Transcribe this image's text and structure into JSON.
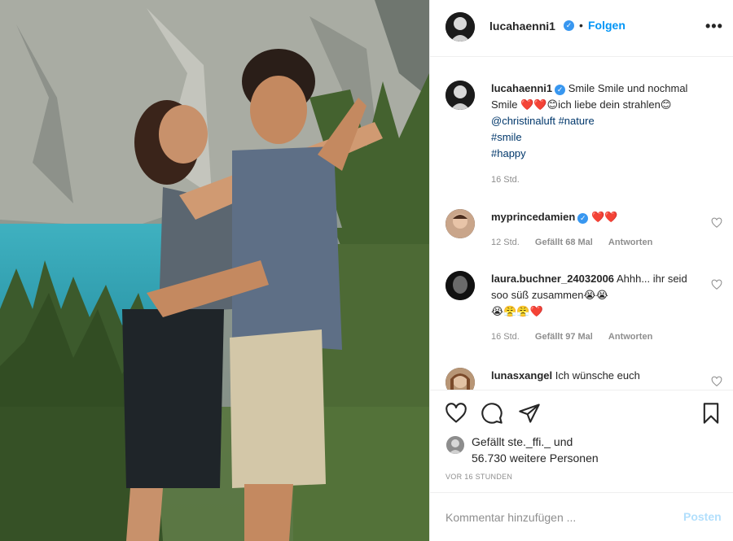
{
  "post": {
    "author": "lucahaenni1",
    "follow_label": "Folgen",
    "dot": "•",
    "more_label": "•••"
  },
  "caption": {
    "username": "lucahaenni1",
    "text": "Smile Smile und nochmal Smile",
    "text2": "ich liebe dein strahlen",
    "mention": "@christinaluft",
    "tags": [
      "#nature",
      "#smile",
      "#happy"
    ],
    "time": "16 Std."
  },
  "comments": [
    {
      "username": "myprincedamien",
      "text": "",
      "time": "12 Std.",
      "likes": "Gefällt 68 Mal",
      "reply": "Antworten"
    },
    {
      "username": "laura.buchner_24032006",
      "text": "Ahhh... ihr seid soo süß zusammen",
      "time": "16 Std.",
      "likes": "Gefällt 97 Mal",
      "reply": "Antworten"
    },
    {
      "username": "lunasxangel",
      "text": "Ich wünsche euch"
    }
  ],
  "likes_text_1": "Gefällt ste._ffi._ und",
  "likes_text_2": "56.730 weitere Personen",
  "time_ago": "VOR 16 STUNDEN",
  "add_comment": {
    "placeholder": "Kommentar hinzufügen ...",
    "post_label": "Posten"
  },
  "icons": {
    "like": "heart-icon",
    "comment": "comment-icon",
    "share": "paper-plane-icon",
    "save": "bookmark-icon",
    "verified": "verified-badge-icon",
    "more": "more-options-icon"
  },
  "colors": {
    "link_blue": "#0095f6",
    "verified_blue": "#3897f0",
    "heart_red": "#ed4956",
    "muted": "#8e8e8e",
    "post_disabled": "#b2dffc"
  }
}
